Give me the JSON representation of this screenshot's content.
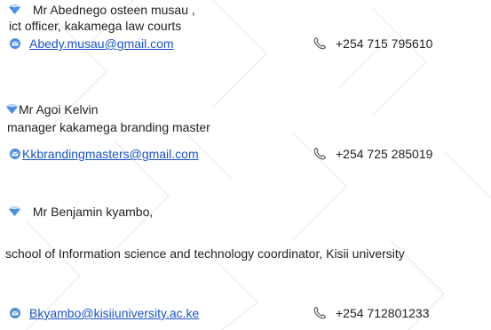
{
  "referees": [
    {
      "name": "Mr Abednego osteen musau ,",
      "role": "ict officer, kakamega law courts",
      "email": "Abedy.musau@gmail.com",
      "phone": "+254 715 795610"
    },
    {
      "name": "Mr Agoi Kelvin",
      "role": "manager kakamega branding master",
      "email": "Kkbrandingmasters@gmail.com",
      "phone": "+254 725 285019"
    },
    {
      "name": "Mr Benjamin kyambo,",
      "role": "school of Information science and technology coordinator, Kisii university",
      "email": "Bkyambo@kisiiuniversity.ac.ke",
      "phone": "+254 712801233"
    }
  ],
  "colors": {
    "link": "#1a55c8",
    "icon_blue": "#4a8fe0",
    "icon_light": "#a9cdf3",
    "watermark": "#e8e8e8"
  },
  "icons": {
    "referee": "diamond-heart-icon",
    "email": "email-icon",
    "phone": "phone-icon"
  }
}
